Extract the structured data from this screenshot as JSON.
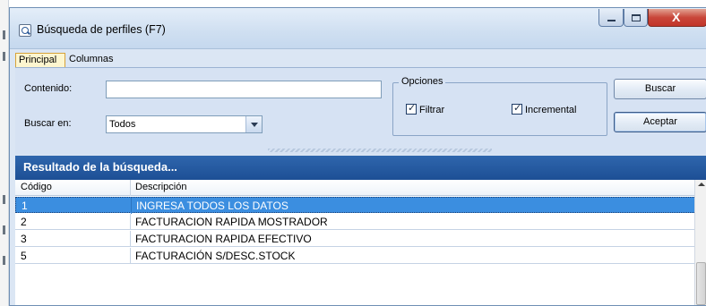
{
  "window": {
    "title": "Búsqueda de perfiles (F7)",
    "close_glyph": "X"
  },
  "tabs": [
    {
      "label": "Principal",
      "active": true
    },
    {
      "label": "Columnas",
      "active": false
    }
  ],
  "form": {
    "contenido_label": "Contenido:",
    "contenido_value": "",
    "buscar_en_label": "Buscar en:",
    "buscar_en_value": "Todos"
  },
  "options": {
    "legend": "Opciones",
    "filtrar_label": "Filtrar",
    "filtrar_checked": true,
    "incremental_label": "Incremental",
    "incremental_checked": true
  },
  "buttons": {
    "buscar": "Buscar",
    "aceptar": "Aceptar"
  },
  "results": {
    "heading": "Resultado de la búsqueda...",
    "columns": [
      "Código",
      "Descripción"
    ],
    "rows": [
      {
        "codigo": "1",
        "descripcion": "INGRESA TODOS LOS DATOS",
        "selected": true
      },
      {
        "codigo": "2",
        "descripcion": "FACTURACION RAPIDA MOSTRADOR",
        "selected": false
      },
      {
        "codigo": "3",
        "descripcion": "FACTURACION RAPIDA EFECTIVO",
        "selected": false
      },
      {
        "codigo": "5",
        "descripcion": "FACTURACIÓN S/DESC.STOCK",
        "selected": false
      }
    ]
  },
  "icons": {
    "window": "search-profile-icon",
    "minimize": "minimize-icon",
    "maximize": "maximize-icon",
    "close": "close-icon",
    "dropdown": "chevron-down-icon",
    "scroll": "scroll-up-icon"
  },
  "colors": {
    "selection": "#3b8ee0",
    "results_header": "#1d4f95",
    "panel": "#d6e2f3",
    "close_button": "#c9463a"
  }
}
